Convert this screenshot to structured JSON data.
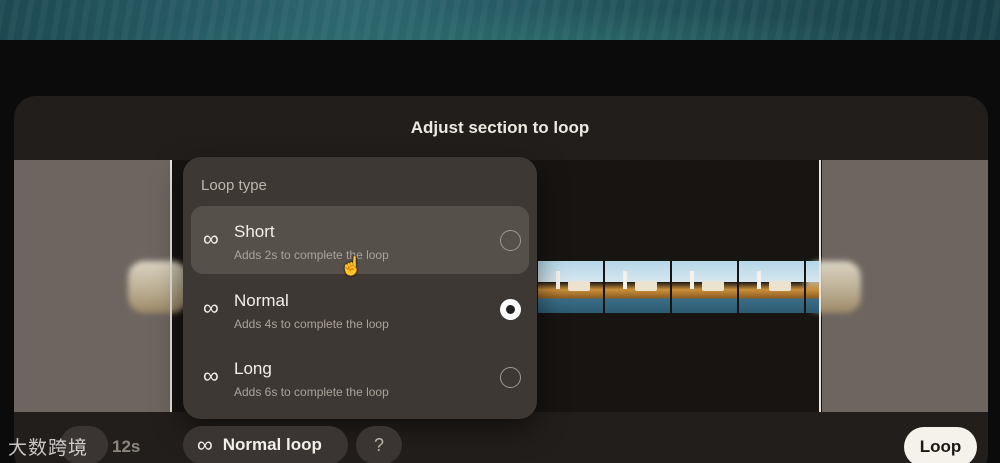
{
  "panel": {
    "title": "Adjust section to loop"
  },
  "popup": {
    "title": "Loop type",
    "options": [
      {
        "label": "Short",
        "description": "Adds 2s to complete the loop",
        "selected": false,
        "hovered": true,
        "icon": "infinity-icon"
      },
      {
        "label": "Normal",
        "description": "Adds 4s to complete the loop",
        "selected": true,
        "hovered": false,
        "icon": "infinity-icon"
      },
      {
        "label": "Long",
        "description": "Adds 6s to complete the loop",
        "selected": false,
        "hovered": false,
        "icon": "infinity-icon"
      }
    ]
  },
  "toolbar": {
    "duration": "12s",
    "loop_type_chip": "Normal loop",
    "help": "?",
    "loop_button": "Loop"
  },
  "watermark": "大数跨境",
  "colors": {
    "panel": "#221e1b",
    "popup": "#3e3834",
    "accent_button": "#f5f2ec"
  }
}
